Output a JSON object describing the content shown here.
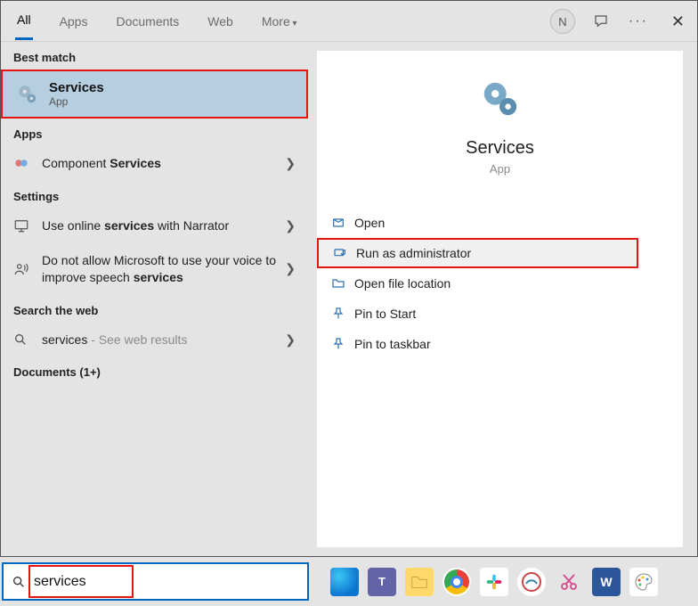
{
  "tabs": {
    "all": "All",
    "apps": "Apps",
    "documents": "Documents",
    "web": "Web",
    "more": "More"
  },
  "avatar_letter": "N",
  "sections": {
    "best_match": "Best match",
    "apps": "Apps",
    "settings": "Settings",
    "search_web": "Search the web",
    "documents": "Documents (1+)"
  },
  "best": {
    "title": "Services",
    "sub": "App"
  },
  "apps_row": {
    "pre": "Component ",
    "bold": "Services"
  },
  "settings_rows": {
    "r1a": "Use online ",
    "r1b": "services",
    "r1c": " with Narrator",
    "r2a": "Do not allow Microsoft to use your voice to improve speech ",
    "r2b": "services"
  },
  "web_row": {
    "term": "services",
    "suffix": " - See web results"
  },
  "right": {
    "title": "Services",
    "sub": "App"
  },
  "actions": {
    "open": "Open",
    "run_admin": "Run as administrator",
    "open_loc": "Open file location",
    "pin_start": "Pin to Start",
    "pin_task": "Pin to taskbar"
  },
  "search_value": "services"
}
